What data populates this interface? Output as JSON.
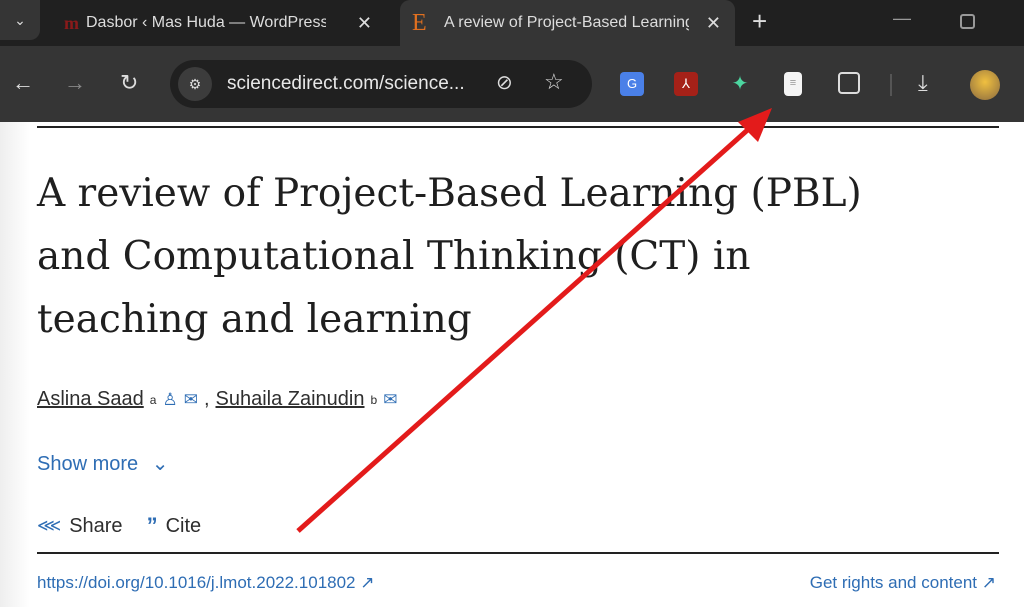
{
  "tabs": [
    {
      "label": "Dasbor ‹ Mas Huda — WordPress",
      "favicon": "m"
    },
    {
      "label": "A review of Project-Based Learning",
      "favicon": "E",
      "active": true
    }
  ],
  "toolbar": {
    "url": "sciencedirect.com/science..."
  },
  "article": {
    "title_lines": [
      "A review of Project-Based Learning (PBL)",
      "and Computational Thinking (CT) in",
      "teaching and learning"
    ],
    "authors": [
      {
        "name": "Aslina Saad",
        "sup": "a"
      },
      {
        "name": "Suhaila Zainudin",
        "sup": "b"
      }
    ],
    "separator": ",",
    "show_more": "Show more",
    "share": "Share",
    "cite": "Cite",
    "doi": "https://doi.org/10.1016/j.lmot.2022.101802",
    "rights": "Get rights and content"
  },
  "annotation": {
    "color": "#e31b1b"
  }
}
